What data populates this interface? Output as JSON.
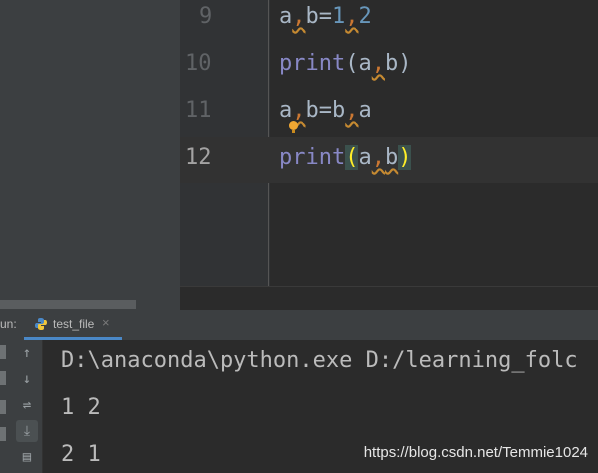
{
  "editor": {
    "lines": [
      {
        "number": "9",
        "code": "a,b=1,2"
      },
      {
        "number": "10",
        "code": "print(a,b)"
      },
      {
        "number": "11",
        "code": "a,b=b,a"
      },
      {
        "number": "12",
        "code": "print(a,b)"
      }
    ],
    "tokens": {
      "a": "a",
      "b": "b",
      "comma": ",",
      "eq": "=",
      "one": "1",
      "two": "2",
      "print": "print",
      "lparen": "(",
      "rparen": ")"
    },
    "current_line": 12
  },
  "run_panel": {
    "label": "un:",
    "tab_label": "test_file",
    "tab_close": "×"
  },
  "console": {
    "lines": [
      "D:\\anaconda\\python.exe D:/learning_folc",
      "1 2",
      "2 1"
    ]
  },
  "toolbar": {
    "buttons": [
      {
        "name": "scroll-up-icon",
        "glyph": "↑"
      },
      {
        "name": "scroll-down-icon",
        "glyph": "↓"
      },
      {
        "name": "soft-wrap-icon",
        "glyph": "⇌"
      },
      {
        "name": "scroll-to-end-icon",
        "glyph": "⤓"
      },
      {
        "name": "print-icon",
        "glyph": "▤"
      }
    ]
  },
  "watermark": "https://blog.csdn.net/Temmie1024",
  "colors": {
    "background": "#2b2b2b",
    "keyword": "#8888c6",
    "number": "#6897bb",
    "comma": "#cc7832",
    "text": "#a9b7c6",
    "tab_underline": "#4a88c7"
  }
}
